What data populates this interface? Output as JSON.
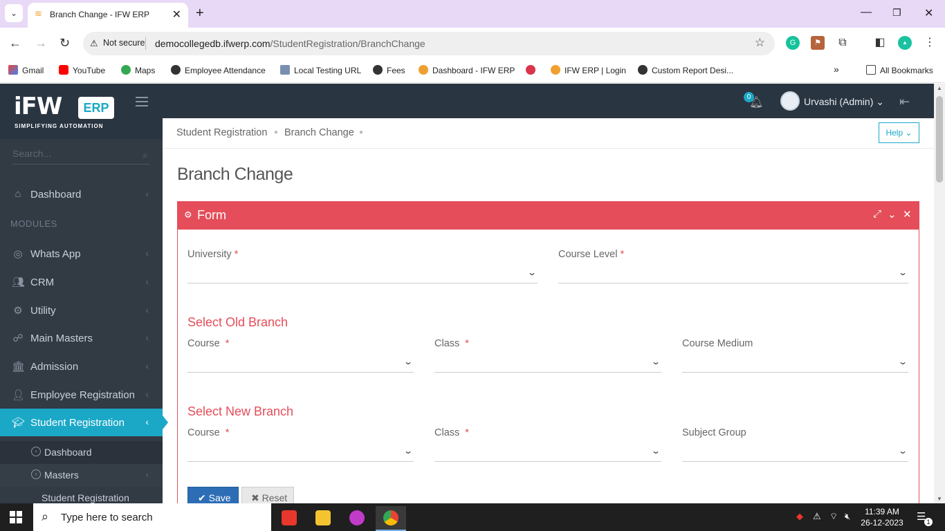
{
  "browser": {
    "tab_title": "Branch Change - IFW ERP",
    "new_tab_symbol": "+",
    "security_label": "Not secure",
    "url_host": "democollegedb.ifwerp.com",
    "url_path": "/StudentRegistration/BranchChange",
    "bookmarks": [
      "Gmail",
      "YouTube",
      "Maps",
      "Employee Attendance",
      "Local Testing URL",
      "Fees",
      "Dashboard - IFW ERP",
      "IFW ERP | Login",
      "Custom Report Desi..."
    ],
    "all_bookmarks": "All Bookmarks"
  },
  "app": {
    "logo_text": "iFW",
    "logo_badge": "ERP",
    "logo_tagline": "SIMPLIFYING AUTOMATION",
    "notification_count": "0",
    "user_name": "Urvashi (Admin)",
    "user_caret": "⌄"
  },
  "sidebar": {
    "search_placeholder": "Search...",
    "modules_header": "MODULES",
    "items": [
      {
        "label": "Dashboard",
        "icon": "home-icon"
      },
      {
        "label": "Whats App",
        "icon": "whatsapp-icon"
      },
      {
        "label": "CRM",
        "icon": "users-icon"
      },
      {
        "label": "Utility",
        "icon": "cogs-icon"
      },
      {
        "label": "Main Masters",
        "icon": "sitemap-icon"
      },
      {
        "label": "Admission",
        "icon": "bank-icon"
      },
      {
        "label": "Employee Registration",
        "icon": "user-icon"
      },
      {
        "label": "Student Registration",
        "icon": "graduation-cap-icon"
      }
    ],
    "sub_items": [
      "Dashboard",
      "Masters"
    ],
    "sub_sub_item": "Student Registration"
  },
  "breadcrumb": [
    "Student Registration",
    "Branch Change"
  ],
  "help_label": "Help",
  "page_title": "Branch Change",
  "form": {
    "title": "Form",
    "university_label": "University",
    "course_level_label": "Course Level",
    "old_branch_title": "Select Old Branch",
    "new_branch_title": "Select New Branch",
    "course_label": "Course",
    "class_label": "Class",
    "course_medium_label": "Course Medium",
    "subject_group_label": "Subject Group",
    "required_mark": "*",
    "save_label": "Save",
    "reset_label": "Reset"
  },
  "taskbar": {
    "search_text": "Type here to search",
    "time": "11:39 AM",
    "date": "26-12-2023",
    "notification_badge": "1"
  },
  "colors": {
    "accent": "#1ba8c7",
    "form_header": "#e44d59",
    "sidebar": "#323a44",
    "header": "#2a3542",
    "save_button": "#2d6db5"
  }
}
